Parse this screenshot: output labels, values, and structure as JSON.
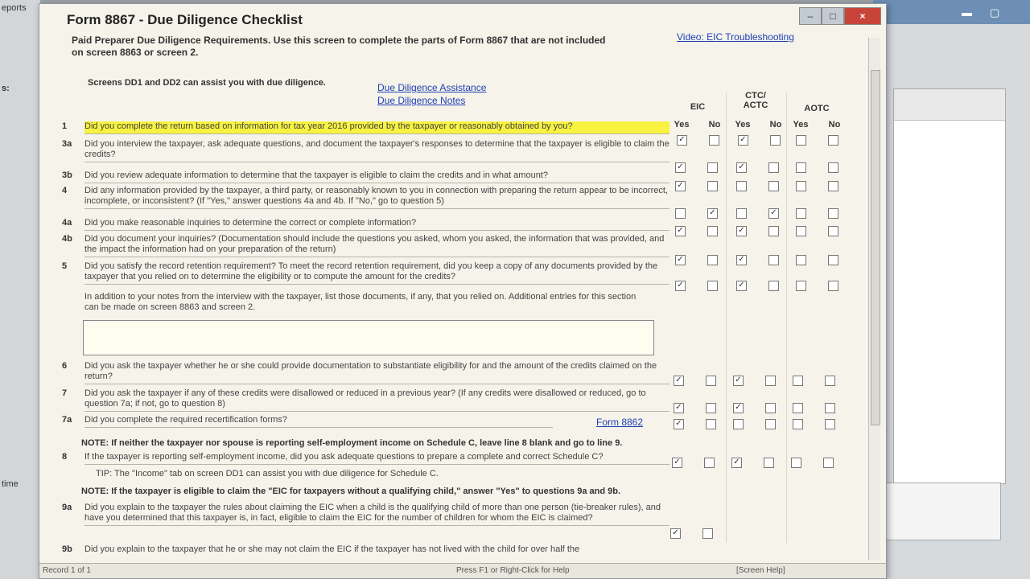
{
  "window": {
    "title": "Form 8867 - Due Diligence Checklist",
    "close_label": "×"
  },
  "links": {
    "video": "Video: EIC Troubleshooting",
    "assistance": "Due Diligence Assistance",
    "notes": "Due Diligence Notes",
    "form8862": "Form 8862"
  },
  "intro": "Paid Preparer Due Diligence Requirements. Use this screen to complete the parts of Form 8867 that are not included on screen 8863 or screen 2.",
  "screens_note": "Screens DD1 and DD2 can assist you with due diligence.",
  "columns": {
    "eic": "EIC",
    "ctc": "CTC/ ACTC",
    "aotc": "AOTC",
    "yes": "Yes",
    "no": "No"
  },
  "questions": [
    {
      "num": "1",
      "text": "Did you complete the return based on information for tax year 2016 provided by the taxpayer or reasonably obtained by you?"
    },
    {
      "num": "3a",
      "text": "Did you interview the taxpayer, ask adequate questions, and document the taxpayer's responses to determine that the taxpayer is eligible to claim the credits?"
    },
    {
      "num": "3b",
      "text": "Did you review adequate information to determine that the taxpayer is eligible to claim the credits and in what amount?"
    },
    {
      "num": "4",
      "text": "Did any information provided by the taxpayer, a third party, or reasonably known to you in connection with preparing the return appear to be incorrect, incomplete, or inconsistent? (If \"Yes,\" answer questions 4a and 4b. If \"No,\" go to question 5)"
    },
    {
      "num": "4a",
      "text": "Did you make reasonable inquiries to determine the correct or complete information?"
    },
    {
      "num": "4b",
      "text": "Did you document your inquiries? (Documentation should include the questions you asked, whom you asked, the information that was provided, and the impact the information had on your preparation of the return)"
    },
    {
      "num": "5",
      "text": "Did you satisfy the record retention requirement? To meet the record retention requirement, did you keep a copy of any documents provided by the taxpayer that you relied on to determine the eligibility or to compute the amount for the credits?"
    },
    {
      "num": "6",
      "text": "Did you ask the taxpayer whether he or she could provide documentation to substantiate eligibility for and the amount of the credits claimed on the return?"
    },
    {
      "num": "7",
      "text": "Did you ask the taxpayer if any of these credits were disallowed or reduced in a previous year? (If any credits were disallowed or reduced, go to question 7a; if not, go to question 8)"
    },
    {
      "num": "7a",
      "text": "Did you complete the required recertification forms?"
    },
    {
      "num": "8",
      "text": "If the taxpayer is reporting self-employment income, did you ask adequate questions to prepare a complete and correct Schedule C?"
    },
    {
      "num": "9a",
      "text": "Did you explain to the taxpayer the rules about claiming the EIC when a child is the qualifying child of more than one person (tie-breaker rules), and have you determined that this taxpayer is, in fact, eligible to claim the EIC for the number of children for whom the EIC is claimed?"
    },
    {
      "num": "9b",
      "text": "Did you explain to the taxpayer that he or she may not claim the EIC if the taxpayer has not lived with the child for over half the"
    }
  ],
  "q5_extra": "In addition to your notes from the interview with the taxpayer, list those documents, if any, that you relied on. Additional entries for this section can be made on screen 8863 and screen 2.",
  "note_line8": "NOTE: If neither the taxpayer nor spouse is reporting self-employment income on Schedule C, leave line 8 blank and go to line 9.",
  "tip_line8": "TIP: The \"Income\" tab on screen DD1 can assist you with due diligence for Schedule C.",
  "note_line9": "NOTE: If the taxpayer is eligible to claim the \"EIC for taxpayers without a qualifying child,\" answer \"Yes\" to questions 9a and 9b.",
  "status": {
    "record": "Record 1 of 1",
    "help": "Press F1 or Right-Click for Help",
    "screen_help": "[Screen Help]"
  },
  "background": {
    "left_1": "eports",
    "left_2": "s:",
    "left_3": "time"
  }
}
